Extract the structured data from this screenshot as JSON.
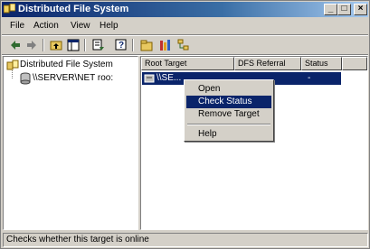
{
  "window": {
    "title": "Distributed File System",
    "minimize_label": "_",
    "maximize_label": "□",
    "close_label": "×"
  },
  "menubar": {
    "items": [
      "File",
      "Action",
      "View",
      "Help"
    ]
  },
  "toolbar": {
    "icons": [
      "back-icon",
      "forward-icon",
      "up-folder-icon",
      "show-tree-icon",
      "export-list-icon",
      "help-icon",
      "new-root-icon",
      "properties-icon",
      "tree-icon"
    ]
  },
  "tree": {
    "root_label": "Distributed File System",
    "child_label": "\\\\SERVER\\NET roo:"
  },
  "list": {
    "columns": [
      "Root Target",
      "DFS Referral",
      "Status"
    ],
    "rows": [
      {
        "target": "\\\\SE...",
        "status": "-"
      }
    ]
  },
  "context_menu": {
    "items": [
      {
        "label": "Open",
        "selected": false
      },
      {
        "label": "Check Status",
        "selected": true
      },
      {
        "label": "Remove Target",
        "selected": false
      },
      {
        "label": "Help",
        "selected": false
      }
    ]
  },
  "statusbar": {
    "text": "Checks whether this target is online"
  },
  "colors": {
    "selection": "#0a246a",
    "face": "#d4d0c8"
  }
}
